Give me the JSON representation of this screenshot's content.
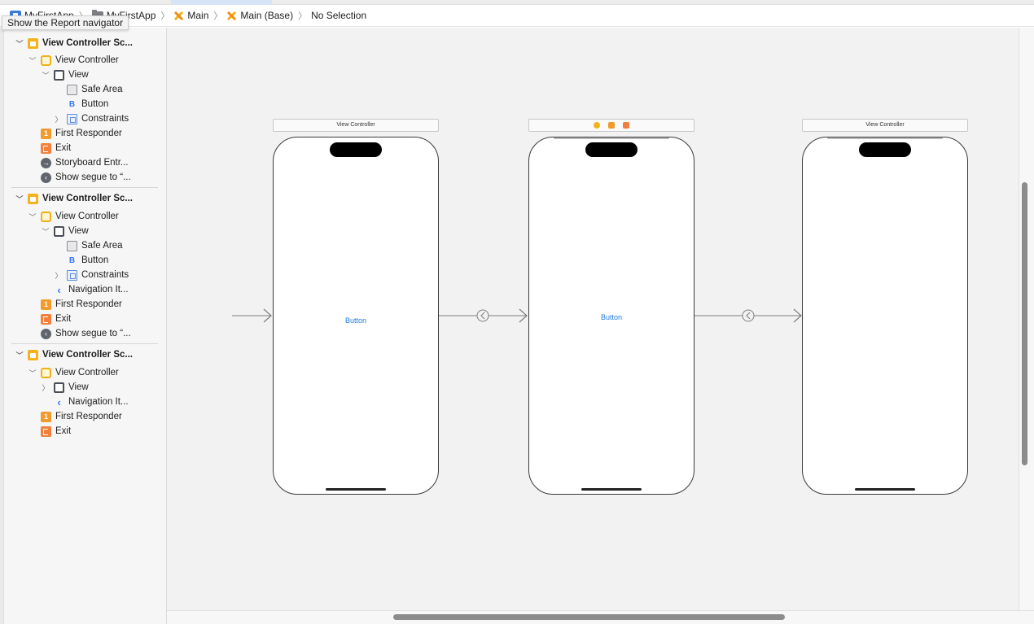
{
  "breadcrumbs": [
    "MyFirstApp",
    "MyFirstApp",
    "Main",
    "Main (Base)",
    "No Selection"
  ],
  "tooltip": "Show the Report navigator",
  "outline": {
    "scenes": [
      {
        "title": "View Controller Sc...",
        "items": {
          "vc": "View Controller",
          "view": "View",
          "safe": "Safe Area",
          "button": "Button",
          "constraints": "Constraints",
          "first": "First Responder",
          "exit": "Exit",
          "entry": "Storyboard Entr...",
          "segue": "Show segue to “..."
        }
      },
      {
        "title": "View Controller Sc...",
        "items": {
          "vc": "View Controller",
          "view": "View",
          "safe": "Safe Area",
          "button": "Button",
          "constraints": "Constraints",
          "nav": "Navigation It...",
          "first": "First Responder",
          "exit": "Exit",
          "segue": "Show segue to “..."
        }
      },
      {
        "title": "View Controller Sc...",
        "items": {
          "vc": "View Controller",
          "view": "View",
          "nav": "Navigation It...",
          "first": "First Responder",
          "exit": "Exit"
        }
      }
    ]
  },
  "canvas": {
    "scene1_bar": "View Controller",
    "scene3_bar": "View Controller",
    "button1": "Button",
    "button2": "Button"
  },
  "colors": {
    "accent": "#3478f6",
    "scene_icon": "#f4b31c",
    "first_responder": "#f39a2d",
    "exit": "#f0803c",
    "canvas_bg": "#f2f2f2"
  },
  "icons": [
    "app-icon",
    "folder-icon",
    "storyboard-icon",
    "chevron-right-icon",
    "chevron-down-icon",
    "scene-icon",
    "view-controller-icon",
    "view-icon",
    "safe-area-icon",
    "button-icon",
    "constraints-icon",
    "navigation-item-icon",
    "first-responder-icon",
    "exit-icon",
    "entry-point-icon",
    "segue-icon"
  ]
}
